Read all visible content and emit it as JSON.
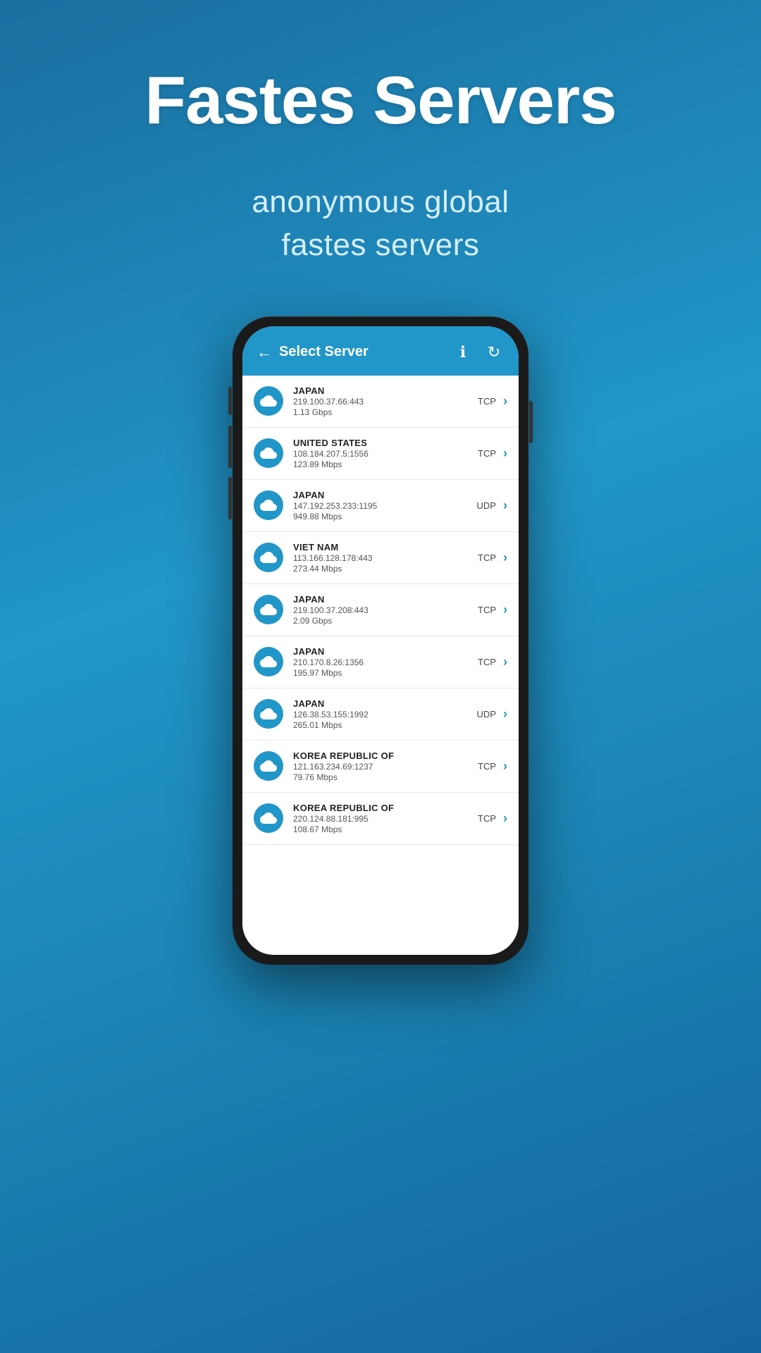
{
  "page": {
    "title": "Fastes Servers",
    "subtitle_line1": "anonymous global",
    "subtitle_line2": "fastes  servers"
  },
  "app": {
    "header": {
      "back_label": "←",
      "title": "Select Server",
      "info_icon": "ℹ",
      "refresh_icon": "↻"
    },
    "servers": [
      {
        "country": "JAPAN",
        "ip": "219.100.37.66:443",
        "speed": "1.13 Gbps",
        "protocol": "TCP"
      },
      {
        "country": "UNITED STATES",
        "ip": "108.184.207.5:1556",
        "speed": "123.89 Mbps",
        "protocol": "TCP"
      },
      {
        "country": "JAPAN",
        "ip": "147.192.253.233:1195",
        "speed": "949.88 Mbps",
        "protocol": "UDP"
      },
      {
        "country": "VIET NAM",
        "ip": "113.166.128.178:443",
        "speed": "273.44 Mbps",
        "protocol": "TCP"
      },
      {
        "country": "JAPAN",
        "ip": "219.100.37.208:443",
        "speed": "2.09 Gbps",
        "protocol": "TCP"
      },
      {
        "country": "JAPAN",
        "ip": "210.170.8.26:1356",
        "speed": "195.97 Mbps",
        "protocol": "TCP"
      },
      {
        "country": "JAPAN",
        "ip": "126.38.53.155:1992",
        "speed": "265.01 Mbps",
        "protocol": "UDP"
      },
      {
        "country": "KOREA REPUBLIC OF",
        "ip": "121.163.234.69:1237",
        "speed": "79.76 Mbps",
        "protocol": "TCP"
      },
      {
        "country": "KOREA REPUBLIC OF",
        "ip": "220.124.88.181:995",
        "speed": "108.67 Mbps",
        "protocol": "TCP"
      }
    ]
  }
}
